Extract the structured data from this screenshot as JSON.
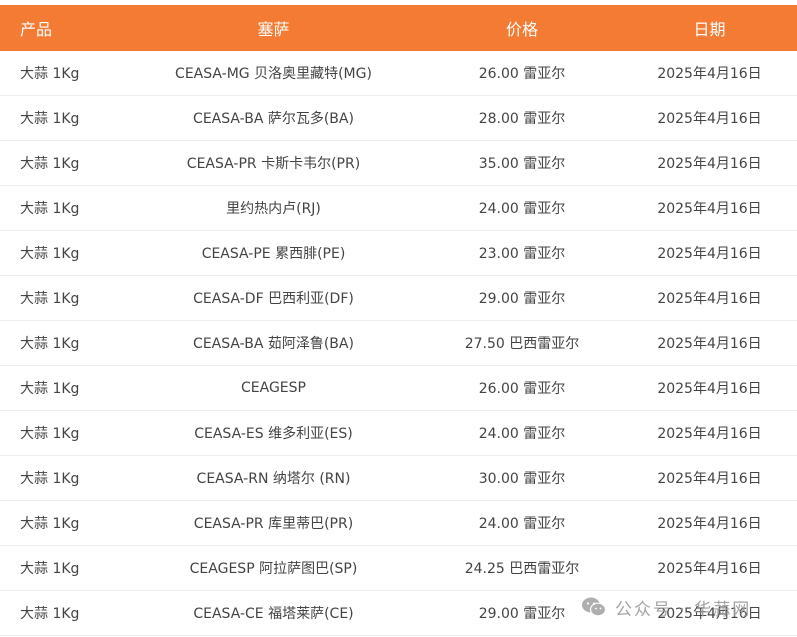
{
  "headers": [
    "产品",
    "塞萨",
    "价格",
    "日期"
  ],
  "rows": [
    [
      "大蒜 1Kg",
      "CEASA-MG 贝洛奥里藏特(MG)",
      "26.00 雷亚尔",
      "2025年4月16日"
    ],
    [
      "大蒜 1Kg",
      "CEASA-BA 萨尔瓦多(BA)",
      "28.00 雷亚尔",
      "2025年4月16日"
    ],
    [
      "大蒜 1Kg",
      "CEASA-PR 卡斯卡韦尔(PR)",
      "35.00 雷亚尔",
      "2025年4月16日"
    ],
    [
      "大蒜 1Kg",
      "里约热内卢(RJ)",
      "24.00 雷亚尔",
      "2025年4月16日"
    ],
    [
      "大蒜 1Kg",
      "CEASA-PE 累西腓(PE)",
      "23.00 雷亚尔",
      "2025年4月16日"
    ],
    [
      "大蒜 1Kg",
      "CEASA-DF 巴西利亚(DF)",
      "29.00 雷亚尔",
      "2025年4月16日"
    ],
    [
      "大蒜 1Kg",
      "CEASA-BA 茹阿泽鲁(BA)",
      "27.50 巴西雷亚尔",
      "2025年4月16日"
    ],
    [
      "大蒜 1Kg",
      "CEAGESP",
      "26.00 雷亚尔",
      "2025年4月16日"
    ],
    [
      "大蒜 1Kg",
      "CEASA-ES 维多利亚(ES)",
      "24.00 雷亚尔",
      "2025年4月16日"
    ],
    [
      "大蒜 1Kg",
      "CEASA-RN 纳塔尔 (RN)",
      "30.00 雷亚尔",
      "2025年4月16日"
    ],
    [
      "大蒜 1Kg",
      "CEASA-PR 库里蒂巴(PR)",
      "24.00 雷亚尔",
      "2025年4月16日"
    ],
    [
      "大蒜 1Kg",
      "CEAGESP 阿拉萨图巴(SP)",
      "24.25 巴西雷亚尔",
      "2025年4月16日"
    ],
    [
      "大蒜 1Kg",
      "CEASA-CE 福塔莱萨(CE)",
      "29.00 雷亚尔",
      "2025年4月16日"
    ]
  ],
  "watermark": {
    "text": "公众号 · 华蒜网",
    "icon": "wechat-icon"
  },
  "colors": {
    "header_bg": "#f37b34",
    "header_text": "#ffffff",
    "row_text": "#444444",
    "divider": "#ececec"
  }
}
